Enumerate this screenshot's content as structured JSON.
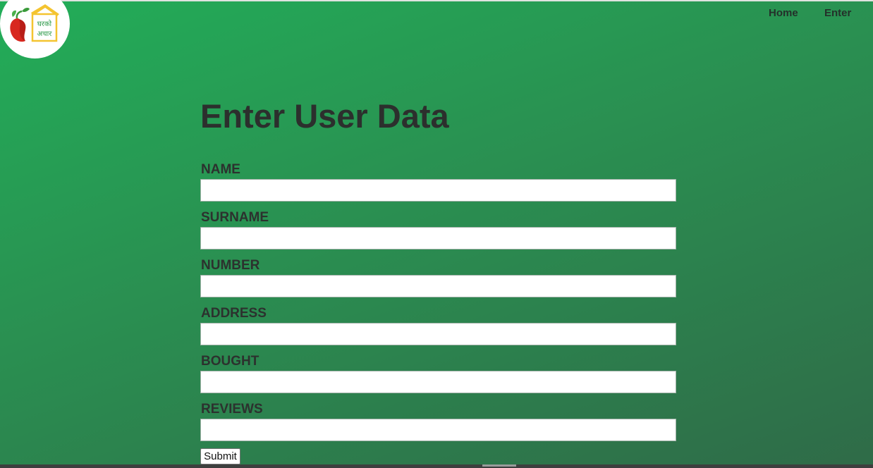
{
  "brand": {
    "logo_icon": "achar-pickle-house-logo-icon",
    "logo_text": "घरको अचार"
  },
  "nav": {
    "items": [
      {
        "label": "Home"
      },
      {
        "label": "Enter"
      }
    ]
  },
  "form": {
    "title": "Enter User Data",
    "fields": [
      {
        "label": "NAME",
        "value": ""
      },
      {
        "label": "SURNAME",
        "value": ""
      },
      {
        "label": "NUMBER",
        "value": ""
      },
      {
        "label": "ADDRESS",
        "value": ""
      },
      {
        "label": "BOUGHT",
        "value": ""
      },
      {
        "label": "REVIEWS",
        "value": ""
      }
    ],
    "submit_label": "Submit"
  },
  "colors": {
    "background_gradient_start": "#22ad58",
    "background_gradient_end": "#2f6b48",
    "text_dark": "#2c2f2d",
    "logo_house_yellow": "#f4c430",
    "logo_chili_red": "#d8281f",
    "logo_leaf_green": "#3a9a3a"
  }
}
